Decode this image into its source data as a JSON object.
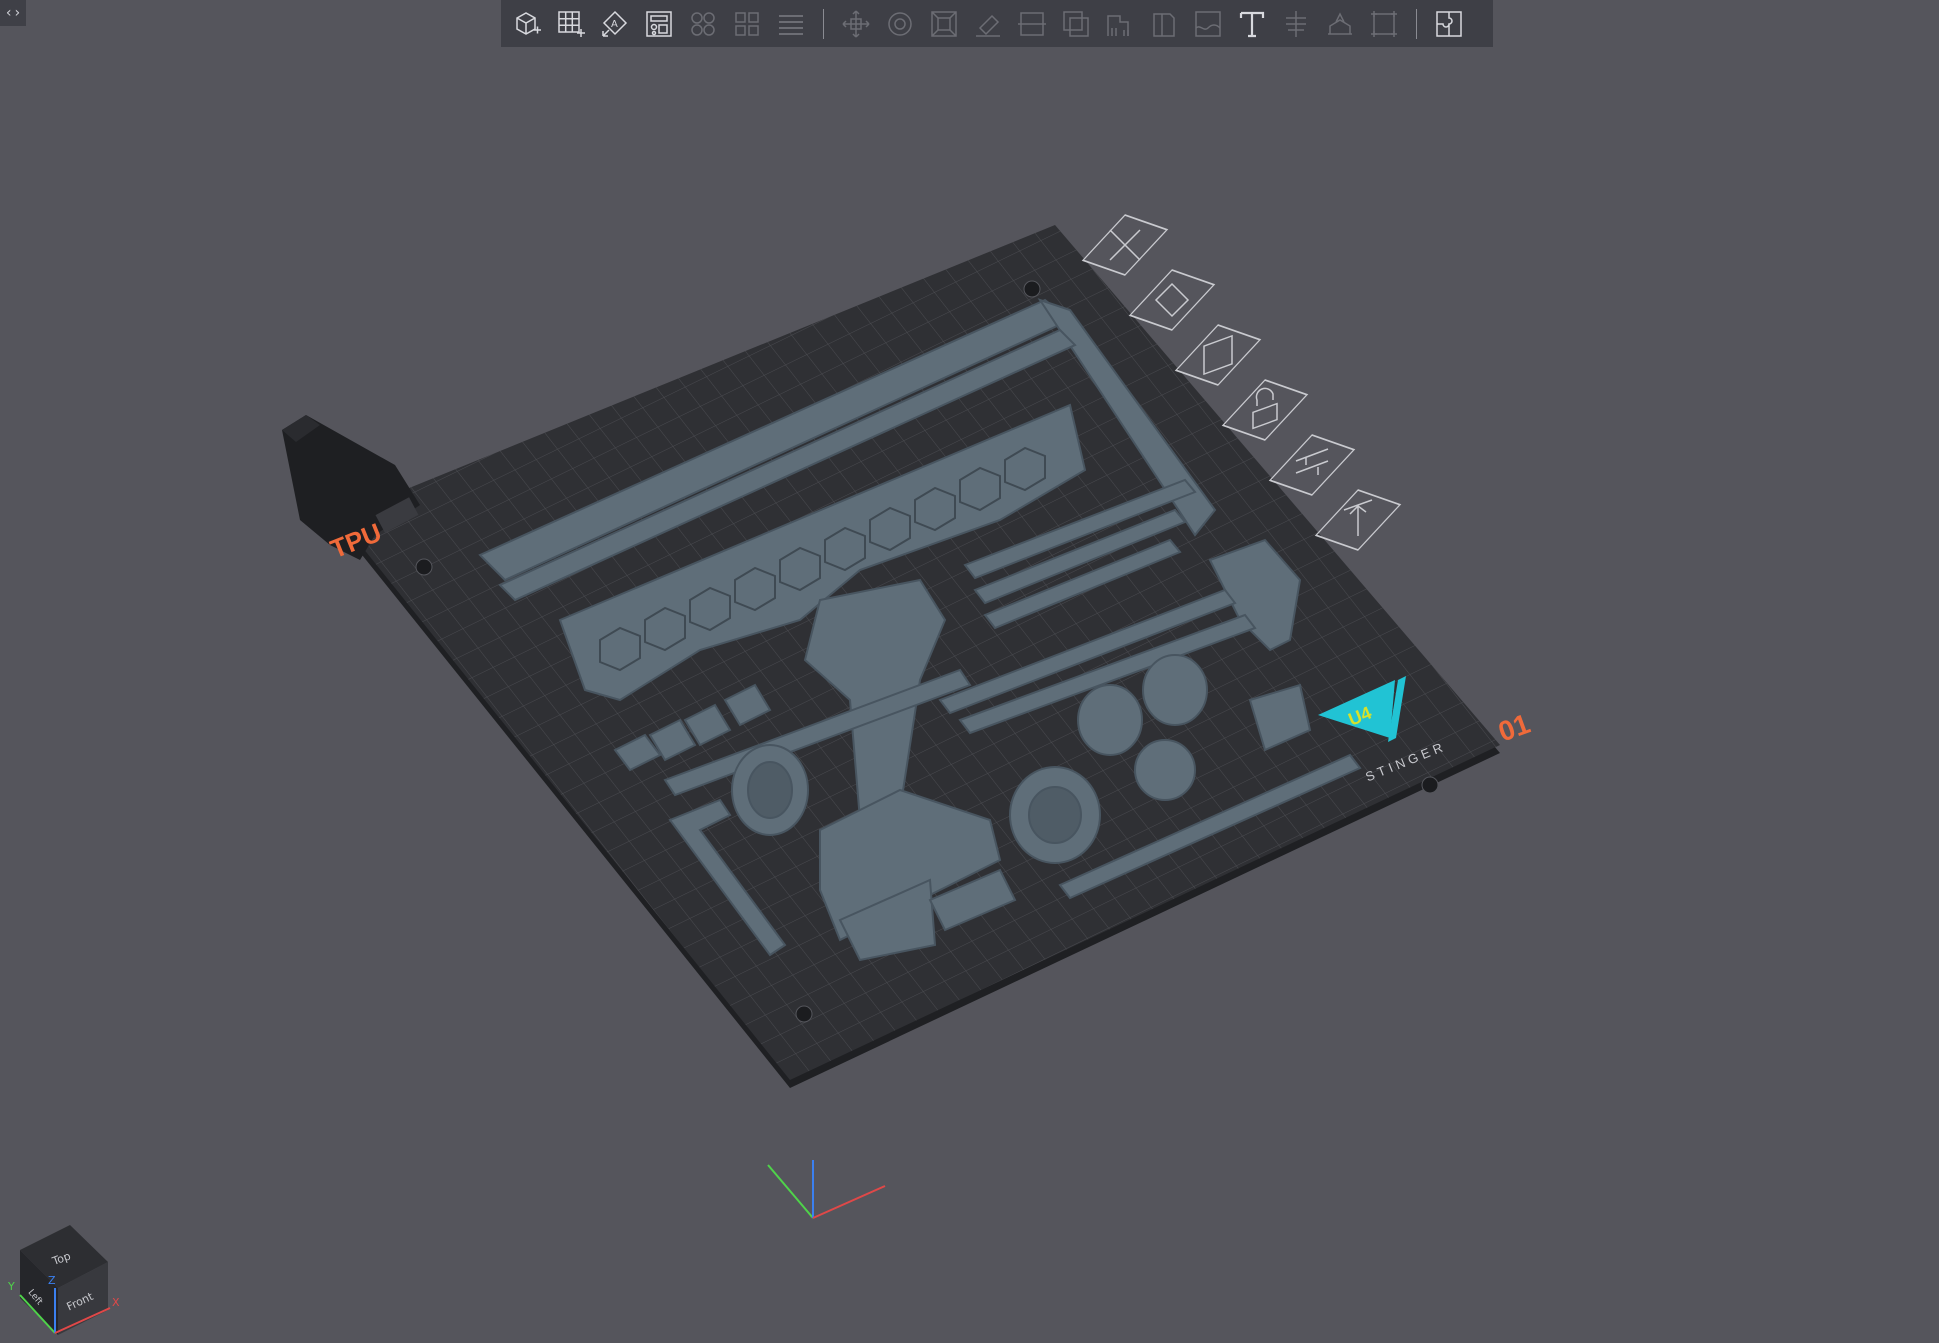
{
  "app": {
    "collapse_icon": "collapse-expand-icon",
    "collapse_glyph": "‹›"
  },
  "toolbar": {
    "group1": [
      {
        "name": "add-object-button",
        "icon": "cube-plus-icon"
      },
      {
        "name": "add-plate-button",
        "icon": "grid-plus-icon"
      },
      {
        "name": "auto-orient-button",
        "icon": "auto-orient-icon"
      },
      {
        "name": "arrange-button",
        "icon": "arrange-icon"
      }
    ],
    "group2": [
      {
        "name": "split-objects-button",
        "icon": "split-objects-icon"
      },
      {
        "name": "split-parts-button",
        "icon": "split-parts-icon"
      },
      {
        "name": "layers-button",
        "icon": "layers-icon"
      }
    ],
    "group3": [
      {
        "name": "move-button",
        "icon": "move-icon"
      },
      {
        "name": "rotate-button",
        "icon": "rotate-icon"
      },
      {
        "name": "scale-button",
        "icon": "scale-icon"
      },
      {
        "name": "lay-on-face-button",
        "icon": "lay-on-face-icon"
      },
      {
        "name": "cut-button",
        "icon": "cut-icon"
      },
      {
        "name": "boolean-button",
        "icon": "boolean-icon"
      },
      {
        "name": "support-paint-button",
        "icon": "support-paint-icon"
      },
      {
        "name": "seam-paint-button",
        "icon": "seam-paint-icon"
      },
      {
        "name": "fuzzy-skin-button",
        "icon": "fuzzy-skin-icon"
      },
      {
        "name": "text-button",
        "icon": "text-icon"
      },
      {
        "name": "measure-button",
        "icon": "measure-icon"
      },
      {
        "name": "assembly-button",
        "icon": "assembly-icon"
      },
      {
        "name": "variable-layer-button",
        "icon": "variable-layer-icon"
      }
    ],
    "group4": [
      {
        "name": "puzzle-button",
        "icon": "puzzle-icon"
      }
    ]
  },
  "plate": {
    "filament_label": "TPU",
    "plate_number": "01",
    "brand_text": "STINGER",
    "brand_badge": "U4",
    "colors": {
      "bed": "#2f3034",
      "grid": "#4a4b50",
      "part": "#5f6e79",
      "part_shadow": "#4a5660",
      "accent_orange": "#f06a3a",
      "brand_cyan": "#21c3d4",
      "brand_yellow": "#d6e12b"
    }
  },
  "plate_tools": [
    {
      "name": "remove-plate-button",
      "icon": "close-icon"
    },
    {
      "name": "plate-auto-orient-button",
      "icon": "auto-orient-icon"
    },
    {
      "name": "plate-arrange-button",
      "icon": "arrange-icon"
    },
    {
      "name": "plate-lock-button",
      "icon": "lock-icon"
    },
    {
      "name": "plate-settings-button",
      "icon": "settings-sliders-icon"
    },
    {
      "name": "plate-move-to-top-button",
      "icon": "move-top-icon"
    }
  ],
  "nav_cube": {
    "top_label": "Top",
    "front_label": "Front",
    "left_label": "Left",
    "axis_x": "X",
    "axis_y": "Y",
    "axis_z": "Z"
  }
}
